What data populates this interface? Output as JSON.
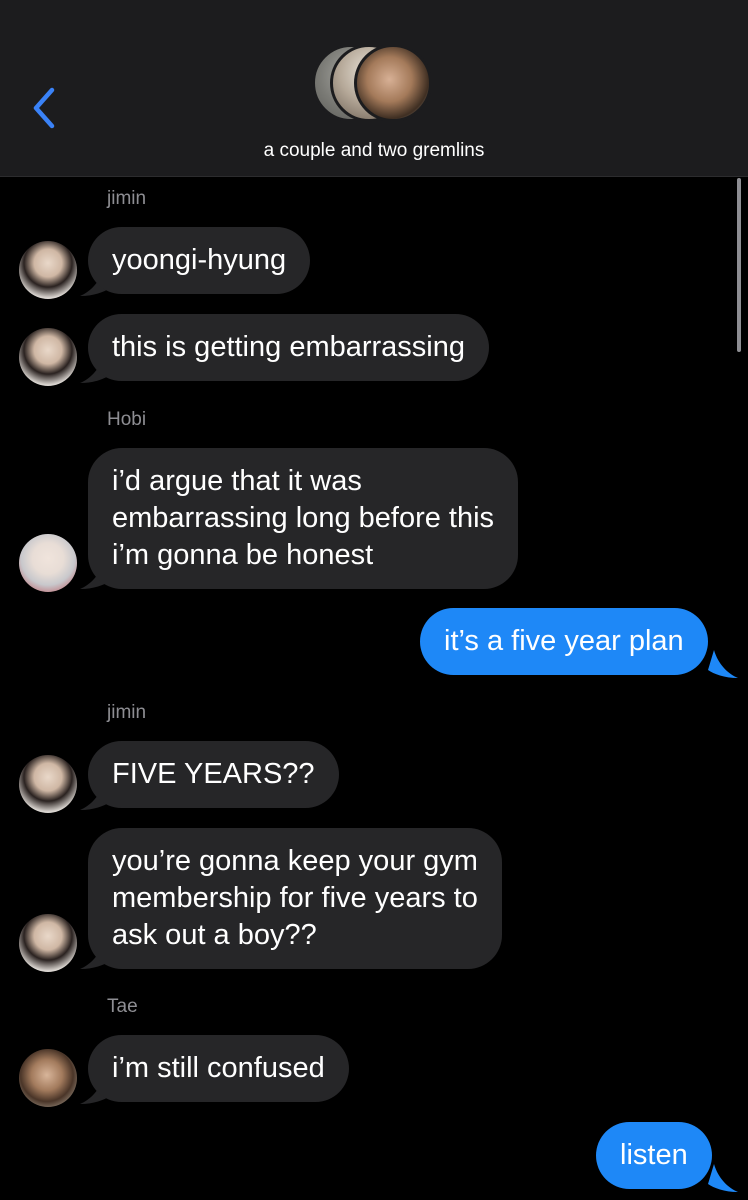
{
  "header": {
    "back_icon": "chevron-left-icon",
    "group_title": "a couple and two gremlins",
    "accent_color": "#3a82f7"
  },
  "colors": {
    "incoming_bubble": "#262628",
    "outgoing_bubble": "#1e88f7",
    "sender_label": "#8e8e93"
  },
  "messages": [
    {
      "sender": "jimin"
    },
    {
      "text": "yoongi-hyung"
    },
    {
      "text": "this is getting embarrassing"
    },
    {
      "sender": "Hobi"
    },
    {
      "lines": [
        "i’d argue that it was",
        "embarrassing long before this",
        "i’m gonna be honest"
      ]
    },
    {
      "text": "it’s a five year plan"
    },
    {
      "sender": "jimin"
    },
    {
      "text": "FIVE YEARS??"
    },
    {
      "lines": [
        "you’re gonna keep your gym",
        "membership for five years to",
        "ask out a boy??"
      ]
    },
    {
      "sender": "Tae"
    },
    {
      "text": "i’m still confused"
    },
    {
      "text": "listen"
    }
  ]
}
